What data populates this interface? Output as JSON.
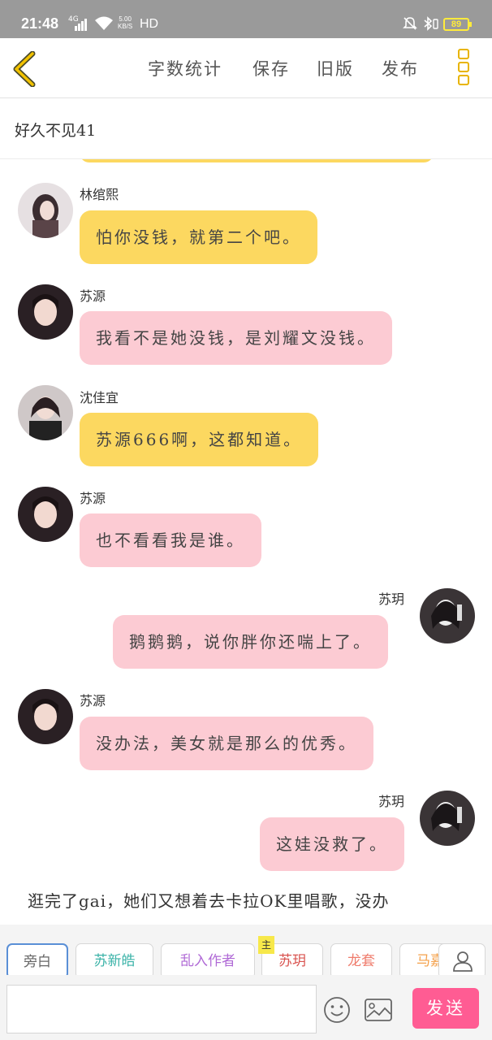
{
  "status_bar": {
    "time": "21:48",
    "signal": "4G",
    "speed_value": "5.00",
    "speed_unit": "KB/S",
    "hd": "HD",
    "battery": "89"
  },
  "toolbar": {
    "word_count": "字数统计",
    "save": "保存",
    "old_version": "旧版",
    "publish": "发布"
  },
  "chat_title": "好久不见41",
  "messages": [
    {
      "sender": "林绾熙",
      "text": "怕你没钱，就第二个吧。",
      "side": "left",
      "color": "yellow"
    },
    {
      "sender": "苏源",
      "text": "我看不是她没钱，是刘耀文没钱。",
      "side": "left",
      "color": "pink"
    },
    {
      "sender": "沈佳宜",
      "text": "苏源666啊，这都知道。",
      "side": "left",
      "color": "yellow"
    },
    {
      "sender": "苏源",
      "text": "也不看看我是谁。",
      "side": "left",
      "color": "pink"
    },
    {
      "sender": "苏玥",
      "text": "鹅鹅鹅，说你胖你还喘上了。",
      "side": "right",
      "color": "pink"
    },
    {
      "sender": "苏源",
      "text": "没办法，美女就是那么的优秀。",
      "side": "left",
      "color": "pink"
    },
    {
      "sender": "苏玥",
      "text": "这娃没救了。",
      "side": "right",
      "color": "pink"
    }
  ],
  "narration": "逛完了gai，她们又想着去卡拉OK里唱歌，没办",
  "roles": [
    {
      "label": "旁白",
      "color": "#666666"
    },
    {
      "label": "苏新皓",
      "color": "#3bb3a8"
    },
    {
      "label": "乱入作者",
      "color": "#b06ad6"
    },
    {
      "label": "苏玥",
      "color": "#d9534f"
    },
    {
      "label": "龙套",
      "color": "#ef7b6b"
    },
    {
      "label": "马嘉",
      "color": "#f4a04a"
    }
  ],
  "main_tag": "主",
  "input": {
    "value": "",
    "placeholder": ""
  },
  "send_label": "发送",
  "colors": {
    "accent": "#e8b400",
    "bubble_yellow": "#fcd860",
    "bubble_pink": "#fccbd3",
    "send_button": "#ff5c93",
    "status_bar": "#9a9a9a"
  },
  "icons": [
    "back-chevron-icon",
    "more-menu-icon",
    "profile-icon",
    "emoji-icon",
    "image-icon"
  ]
}
